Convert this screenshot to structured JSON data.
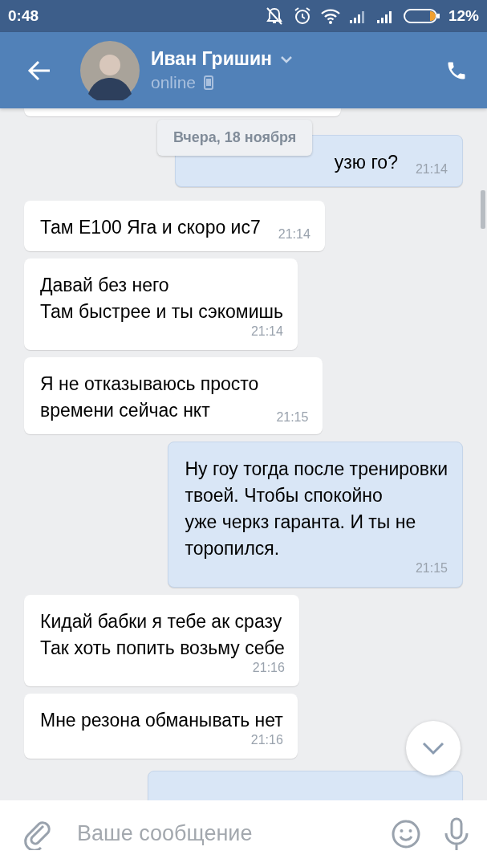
{
  "status_bar": {
    "time": "0:48",
    "battery": "12%"
  },
  "header": {
    "name": "Иван Гришин",
    "status": "online"
  },
  "date_pill": "Вчера, 18 ноября",
  "messages": [
    {
      "kind": "stub"
    },
    {
      "kind": "outgoing",
      "text": "узю го?",
      "time": "21:14"
    },
    {
      "kind": "incoming",
      "text": "Там Е100 Яга и скоро ис7",
      "time": "21:14"
    },
    {
      "kind": "incoming",
      "text": "Давай без него\nТам быстрее и ты сэкомишь",
      "time": "21:14",
      "time_below": true
    },
    {
      "kind": "incoming",
      "text": "Я не отказываюсь просто\nвремени сейчас нкт",
      "time": "21:15"
    },
    {
      "kind": "outgoing",
      "text": "Ну гоу тогда после тренировки\nтвоей. Чтобы спокойно\nуже черкз гаранта. И ты не\nторопился.",
      "time": "21:15",
      "time_below": true
    },
    {
      "kind": "incoming",
      "text": "Кидай бабки я тебе ак сразу\nТак хоть попить возьму себе",
      "time": "21:16",
      "time_below": true
    },
    {
      "kind": "incoming",
      "text": "Мне резона обманывать нет",
      "time": "21:16",
      "time_below": true
    },
    {
      "kind": "outgoing_cut"
    }
  ],
  "composer": {
    "placeholder": "Ваше сообщение"
  }
}
